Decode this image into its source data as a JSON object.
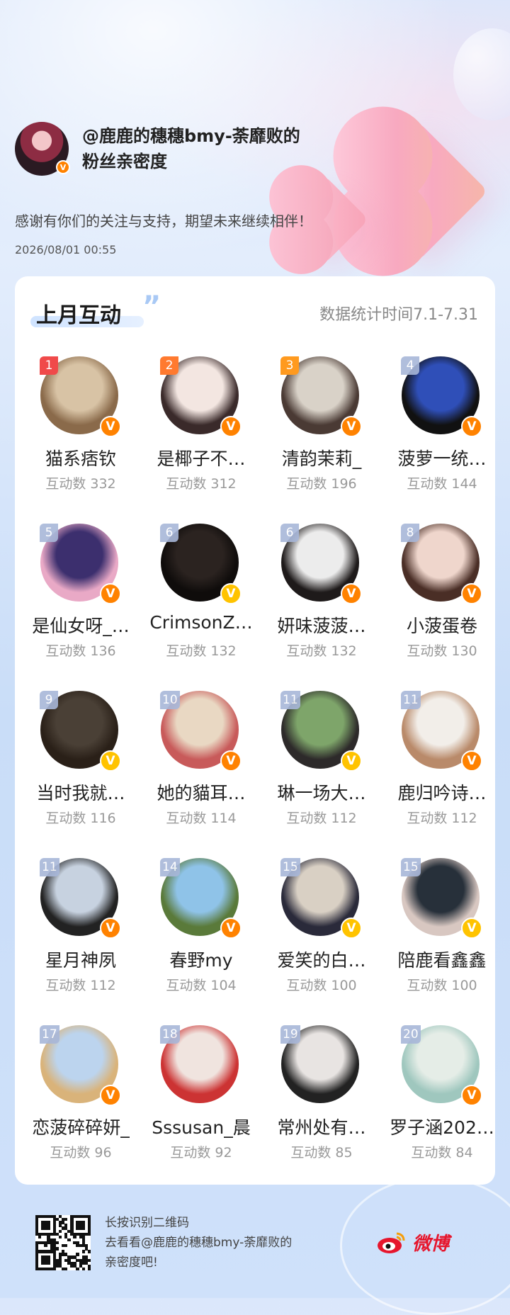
{
  "header": {
    "title": "@鹿鹿的穗穗bmy-荼靡败的粉丝亲密度",
    "thanks": "感谢有你们的关注与支持，期望未来继续相伴！",
    "timestamp": "2026/08/01  00:55"
  },
  "card": {
    "title": "上月互动",
    "period": "数据统计时间7.1-7.31"
  },
  "colors": {
    "rank_top1": "#f04a4a",
    "rank_top2": "#ff7a2f",
    "rank_top3": "#ff9a1f",
    "rank_other": "#a8b7d9",
    "badge_orange": "#ff8200",
    "badge_gold": "#ffc300",
    "weibo_red": "#e6162d"
  },
  "fans": [
    {
      "rank": "1",
      "name": "猫系痞钦",
      "count": "互动数 332",
      "badge": "orange"
    },
    {
      "rank": "2",
      "name": "是椰子不…",
      "count": "互动数 312",
      "badge": "orange"
    },
    {
      "rank": "3",
      "name": "清韵茉莉_",
      "count": "互动数 196",
      "badge": "orange"
    },
    {
      "rank": "4",
      "name": "菠萝一统…",
      "count": "互动数 144",
      "badge": "orange"
    },
    {
      "rank": "5",
      "name": "是仙女呀_…",
      "count": "互动数 136",
      "badge": "orange"
    },
    {
      "rank": "6",
      "name": "CrimsonZ…",
      "count": "互动数 132",
      "badge": "gold"
    },
    {
      "rank": "6",
      "name": "妍味菠菠…",
      "count": "互动数 132",
      "badge": "orange"
    },
    {
      "rank": "8",
      "name": "小菠蛋卷",
      "count": "互动数 130",
      "badge": "orange"
    },
    {
      "rank": "9",
      "name": "当时我就…",
      "count": "互动数 116",
      "badge": "gold"
    },
    {
      "rank": "10",
      "name": "她的貓耳…",
      "count": "互动数 114",
      "badge": "orange"
    },
    {
      "rank": "11",
      "name": "琳一场大…",
      "count": "互动数 112",
      "badge": "gold"
    },
    {
      "rank": "11",
      "name": "鹿归吟诗…",
      "count": "互动数 112",
      "badge": "orange"
    },
    {
      "rank": "11",
      "name": "星月神夙",
      "count": "互动数 112",
      "badge": "orange"
    },
    {
      "rank": "14",
      "name": "春野my",
      "count": "互动数 104",
      "badge": "orange"
    },
    {
      "rank": "15",
      "name": "爱笑的白…",
      "count": "互动数 100",
      "badge": "gold"
    },
    {
      "rank": "15",
      "name": "陪鹿看鑫鑫",
      "count": "互动数 100",
      "badge": "gold"
    },
    {
      "rank": "17",
      "name": "恋菠碎碎妍_",
      "count": "互动数 96",
      "badge": "orange"
    },
    {
      "rank": "18",
      "name": "Sssusan_晨",
      "count": "互动数 92",
      "badge": "none"
    },
    {
      "rank": "19",
      "name": "常州处有…",
      "count": "互动数 85",
      "badge": "none"
    },
    {
      "rank": "20",
      "name": "罗子涵202…",
      "count": "互动数 84",
      "badge": "orange"
    }
  ],
  "footer": {
    "line1": "长按识别二维码",
    "line2": "去看看@鹿鹿的穗穗bmy-荼靡败的",
    "line3": "亲密度吧!",
    "brand": "微博",
    "qr_icon": "qr-code-icon",
    "logo_icon": "weibo-logo-icon"
  },
  "verified_mark": "V"
}
